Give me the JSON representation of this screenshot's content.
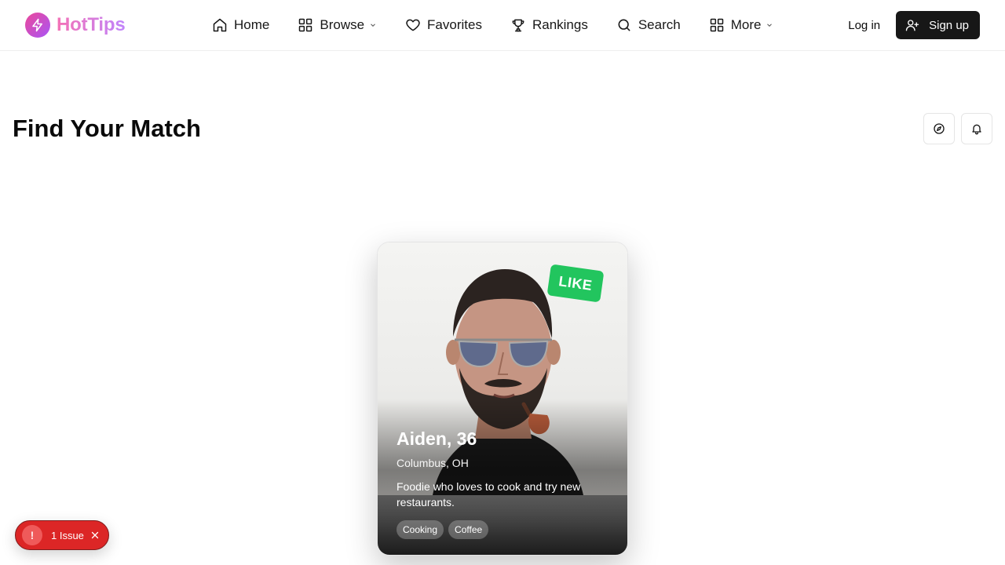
{
  "header": {
    "brand": "HotTips",
    "nav": [
      {
        "label": "Home",
        "icon": "home-icon"
      },
      {
        "label": "Browse",
        "icon": "grid-icon",
        "dropdown": true
      },
      {
        "label": "Favorites",
        "icon": "heart-icon"
      },
      {
        "label": "Rankings",
        "icon": "trophy-icon"
      },
      {
        "label": "Search",
        "icon": "search-icon"
      },
      {
        "label": "More",
        "icon": "grid-icon",
        "dropdown": true
      }
    ],
    "login_label": "Log in",
    "signup_label": "Sign up"
  },
  "main": {
    "title": "Find Your Match",
    "actions": [
      {
        "icon": "compass-icon"
      },
      {
        "icon": "bell-icon"
      }
    ]
  },
  "card": {
    "badge": "LIKE",
    "name": "Aiden, 36",
    "location": "Columbus, OH",
    "bio": "Foodie who loves to cook and try new restaurants.",
    "tags": [
      "Cooking",
      "Coffee"
    ]
  },
  "issue": {
    "icon": "!",
    "label": "1 Issue"
  },
  "colors": {
    "brand_gradient_start": "#ec4899",
    "brand_gradient_end": "#a855f7",
    "like_badge": "#22c55e",
    "signup_bg": "#171717",
    "issue_bg": "#dc2626"
  }
}
